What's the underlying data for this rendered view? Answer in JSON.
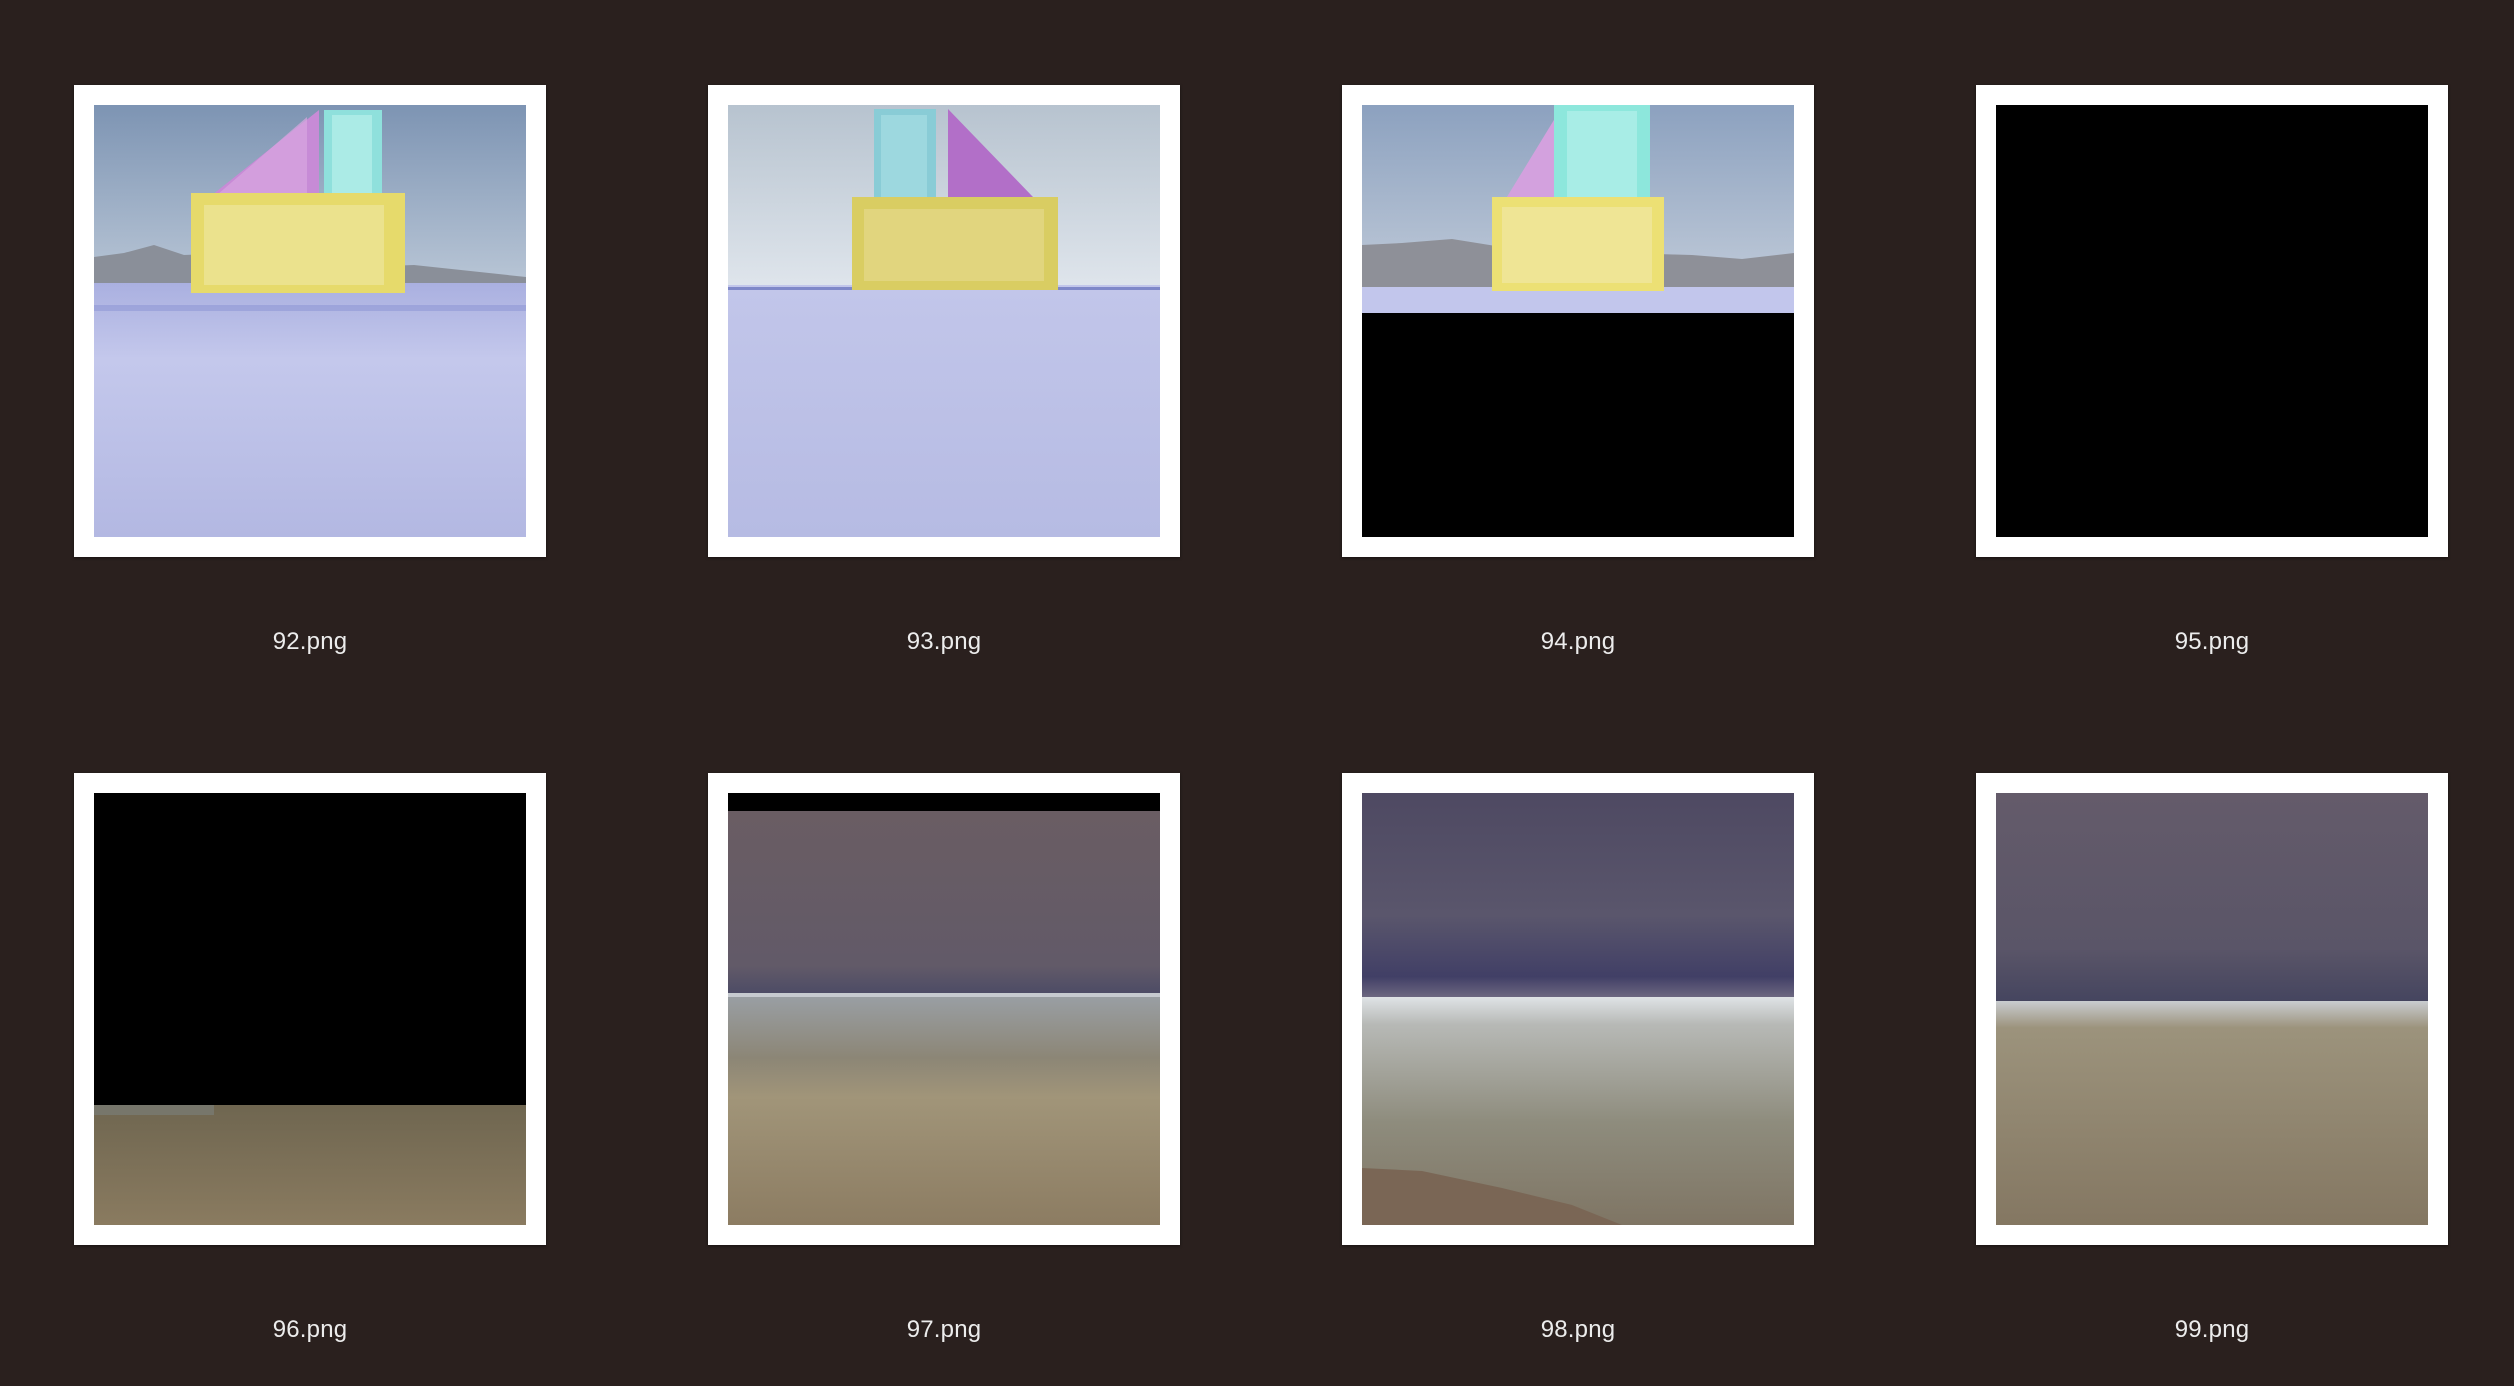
{
  "files": [
    {
      "name": "92.png",
      "thumb": "scene-blocks-a"
    },
    {
      "name": "93.png",
      "thumb": "scene-blocks-b"
    },
    {
      "name": "94.png",
      "thumb": "scene-blocks-partial-black"
    },
    {
      "name": "95.png",
      "thumb": "all-black"
    },
    {
      "name": "96.png",
      "thumb": "black-over-grass"
    },
    {
      "name": "97.png",
      "thumb": "sky-over-grassland"
    },
    {
      "name": "98.png",
      "thumb": "sky-over-valley"
    },
    {
      "name": "99.png",
      "thumb": "sky-over-hills"
    }
  ]
}
